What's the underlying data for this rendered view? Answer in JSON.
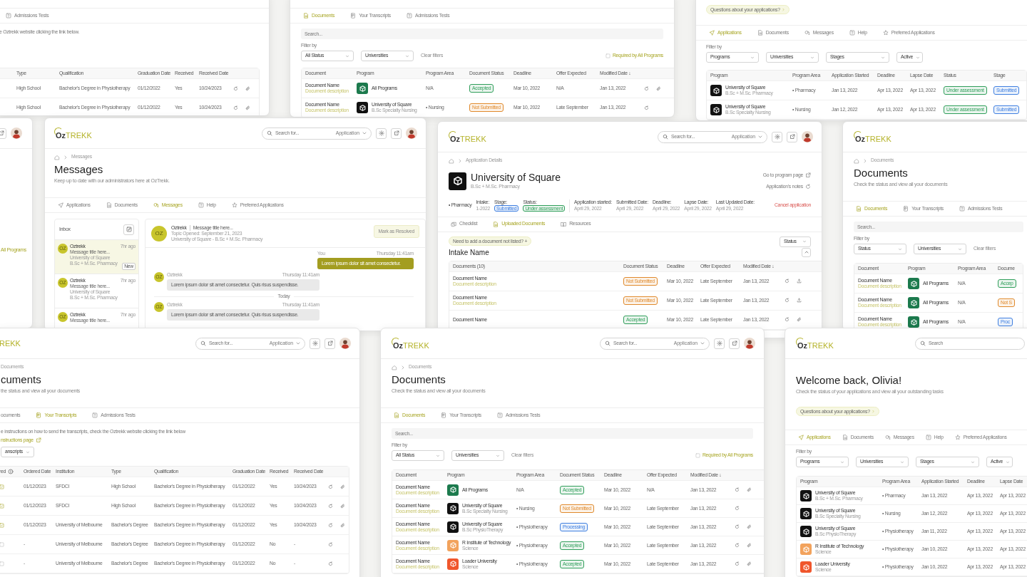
{
  "windows": [
    {
      "sections": [
        {
          "kind": "tabs",
          "items": [
            {
              "label": "Admissions Tests",
              "kind": "help",
              "selected": false
            }
          ]
        },
        {
          "kind": "note",
          "text": "e Oztrekk website clicking the link below."
        },
        {
          "kind": "table",
          "columns": [
            "Type",
            "Qualification",
            "Graduation Date",
            "Received",
            "Received Date"
          ],
          "rows": [
            [
              "High School",
              "Bachelor's Degree in Physiotherapy",
              "01/12/2022",
              "Yes",
              "10/24/2023",
              {
                "kind": "actions",
                "attachment": true
              }
            ],
            [
              "High School",
              "Bachelor's Degree in Physiotherapy",
              "01/12/2022",
              "Yes",
              "10/24/2023",
              {
                "kind": "actions",
                "attachment": true
              }
            ]
          ]
        }
      ]
    },
    {
      "sections": [
        {
          "kind": "tabs",
          "items": [
            {
              "label": "Documents",
              "kind": "doc",
              "selected": true
            },
            {
              "label": "Your Transcripts",
              "kind": "transcript",
              "selected": false
            },
            {
              "label": "Admissions Tests",
              "kind": "help",
              "selected": false
            }
          ]
        },
        {
          "kind": "searchbar",
          "placeholder": "Search..."
        },
        {
          "kind": "filters",
          "label": "Filter by",
          "selects": [
            "All Status",
            "Universities"
          ],
          "clear": "Clear filters",
          "checkbox": {
            "label": "Required by All Programs",
            "checked": false
          }
        },
        {
          "kind": "table",
          "columns": [
            "Document",
            "Program",
            "Program Area",
            "Document Status",
            "Deadline",
            "Offer Expected",
            "Modified Date ↓"
          ],
          "rows": [
            [
              {
                "kind": "doc",
                "name": "Document Name",
                "desc": "Document description"
              },
              {
                "kind": "program",
                "color": "#1c7a4d",
                "name": "All Programs"
              },
              "N/A",
              {
                "kind": "status",
                "text": "Accepted",
                "color": "#2f9e5a"
              },
              "Mar 10, 2022",
              "N/A",
              "Jan 13, 2022",
              {
                "kind": "actions",
                "attachment": true
              }
            ],
            [
              {
                "kind": "doc",
                "name": "Document Name",
                "desc": "Document description"
              },
              {
                "kind": "program",
                "color": "#111111",
                "name": "University of Square",
                "sub": "B.Sc Specialty Nursing"
              },
              "• Nursing",
              {
                "kind": "status",
                "text": "Not Submitted",
                "color": "#e0892b"
              },
              "Mar 10, 2022",
              "Late September",
              "Jan 13, 2022",
              {
                "kind": "actions",
                "attachment": false
              }
            ]
          ]
        }
      ]
    },
    {
      "sections": [
        {
          "kind": "pill",
          "text": "Questions about your applications?",
          "arrow": true
        },
        {
          "kind": "tabs",
          "items": [
            {
              "label": "Applications",
              "kind": "send",
              "selected": true
            },
            {
              "label": "Documents",
              "kind": "doc",
              "selected": false
            },
            {
              "label": "Messages",
              "kind": "chat",
              "selected": false
            },
            {
              "label": "Help",
              "kind": "help",
              "selected": false
            },
            {
              "label": "Preferred Applications",
              "kind": "star",
              "selected": false
            }
          ]
        },
        {
          "kind": "filters",
          "label": "Filter by",
          "selects": [
            "Programs",
            "Universities",
            "Stages",
            "Active"
          ]
        },
        {
          "kind": "table",
          "columns": [
            "Program",
            "Program Area",
            "Application Started",
            "Deadline",
            "Lapse Date",
            "Status",
            "Stage"
          ],
          "rows": [
            [
              {
                "kind": "program",
                "color": "#111111",
                "name": "University of Square",
                "sub": "B.Sc + M.Sc. Pharmacy"
              },
              "• Pharmacy",
              "Jan 13, 2022",
              "Apr 13, 2022",
              "Apr 13, 2022",
              {
                "kind": "status",
                "text": "Under assessment",
                "color": "#2f9e5a"
              },
              {
                "kind": "status",
                "text": "Submitted",
                "color": "#3f7fe0"
              }
            ],
            [
              {
                "kind": "program",
                "color": "#111111",
                "name": "University of Square",
                "sub": "B.Sc Specialty Nursing"
              },
              "• Nursing",
              "Jan 12, 2022",
              "Apr 13, 2022",
              "Apr 13, 2022",
              {
                "kind": "status",
                "text": "Under assessment",
                "color": "#2f9e5a"
              },
              {
                "kind": "status",
                "text": "Submitted",
                "color": "#3f7fe0"
              }
            ]
          ]
        }
      ]
    },
    {
      "sections": [
        {
          "kind": "header",
          "external": true,
          "avatar": true
        },
        {
          "kind": "label",
          "text": "All Programs"
        }
      ]
    },
    {
      "sections": [
        {
          "kind": "header",
          "logo": {
            "a": "Oz",
            "b": "TREKK"
          },
          "placeholder": "Search for...",
          "scope": "Application",
          "tools": true,
          "avatar": true
        },
        {
          "kind": "breadcrumb",
          "home": true,
          "text": "Messages"
        },
        {
          "kind": "title",
          "text": "Messages",
          "sub": "Keep up to date with our administrators here at OzTrekk."
        },
        {
          "kind": "tabs",
          "items": [
            {
              "label": "Applications",
              "kind": "send",
              "selected": false
            },
            {
              "label": "Documents",
              "kind": "doc",
              "selected": false
            },
            {
              "label": "Messages",
              "kind": "chat",
              "selected": true
            },
            {
              "label": "Help",
              "kind": "help",
              "selected": false
            },
            {
              "label": "Preferred Applications",
              "kind": "star",
              "selected": false
            }
          ]
        },
        {
          "kind": "messages",
          "inbox": {
            "title": "Inbox",
            "items": [
              {
                "avatar": "OZ",
                "sender": "Oztrekk",
                "time": "7hr ago",
                "subject": "Message title here...",
                "university": "University of Square",
                "program": "B.Sc + M.Sc. Pharmacy",
                "badge": "New",
                "selected": true
              },
              {
                "avatar": "OZ",
                "sender": "Oztrekk",
                "time": "7hr ago",
                "subject": "Message title here...",
                "university": "University of Square",
                "program": "B.Sc + M.Sc. Pharmacy",
                "selected": false
              },
              {
                "avatar": "OZ",
                "sender": "Oztrekk",
                "time": "7hr ago",
                "subject": "Message title here...",
                "selected": false
              }
            ]
          },
          "thread": {
            "avatar": "OZ",
            "sender": "Oztrekk",
            "subject": "Message title here...",
            "opened": "Topic Opened: September 21, 2023",
            "context": "University of Square - B.Sc + M.Sc. Pharmacy",
            "action": "Mark as Resolved",
            "messages": [
              {
                "kind": "sent",
                "author": "You",
                "time": "Thursday 11:41am",
                "text": "Lorem ipsum dolor sit amet consectetur."
              },
              {
                "kind": "received",
                "avatar": "OZ",
                "author": "Oztrekk",
                "time": "Thursday 11:41am",
                "text": "Lorem ipsum dolor sit amet consectetur. Quis risus suspendisse."
              },
              {
                "kind": "divider",
                "text": "Today"
              },
              {
                "kind": "received",
                "avatar": "OZ",
                "author": "Oztrekk",
                "time": "Thursday 11:41am",
                "text": "Lorem ipsum dolor sit amet consectetur. Quis risus suspendisse."
              }
            ]
          }
        }
      ]
    },
    {
      "sections": [
        {
          "kind": "header",
          "logo": {
            "a": "Oz",
            "b": "TREKK"
          },
          "placeholder": "Search for...",
          "scope": "Application",
          "tools": true,
          "avatar": true
        },
        {
          "kind": "breadcrumb",
          "home": true,
          "text": "Application Details"
        },
        {
          "kind": "apphead",
          "color": "#111111",
          "name": "University of Square",
          "program": "B.Sc + M.Sc. Pharmacy",
          "links": [
            {
              "text": "Go to program page",
              "kind": "external"
            },
            {
              "text": "Application's notes",
              "kind": "notes"
            }
          ]
        },
        {
          "kind": "appinfo",
          "area": "• Pharmacy",
          "left": [
            {
              "label": "Intake:",
              "value": "1-2022"
            },
            {
              "label": "Stage:",
              "value": "Submitted",
              "color": "#3f7fe0"
            },
            {
              "label": "Status:",
              "value": "Under assessment",
              "color": "#2f9e5a"
            }
          ],
          "right": [
            {
              "label": "Application started:",
              "value": "April 29, 2022"
            },
            {
              "label": "Submitted Date:",
              "value": "April 29, 2022"
            },
            {
              "label": "Deadline:",
              "value": "April 29, 2022"
            },
            {
              "label": "Lapse Date:",
              "value": "April 29, 2022"
            },
            {
              "label": "Last Updated Date:",
              "value": "April 29, 2022"
            }
          ],
          "cancel": "Cancel application"
        },
        {
          "kind": "tabs",
          "items": [
            {
              "label": "Checklist",
              "kind": "checklist",
              "selected": false
            },
            {
              "label": "Uploaded Documents",
              "kind": "doc",
              "selected": true
            },
            {
              "label": "Resources",
              "kind": "book",
              "selected": false
            }
          ]
        },
        {
          "kind": "doctoolbar",
          "pill": "Need to add a document not listed? +",
          "select": "Status",
          "heading": "Intake Name"
        },
        {
          "kind": "table",
          "columns": [
            "Documents (10)",
            "Document Status",
            "Deadline",
            "Offer Expected",
            "Modified Date ↓"
          ],
          "rows": [
            [
              {
                "kind": "doc",
                "name": "Document Name",
                "desc": "Document description"
              },
              {
                "kind": "status",
                "text": "Not Submitted",
                "color": "#e0892b"
              },
              "Mar 10, 2022",
              "Late September",
              "Jan 13, 2022",
              {
                "kind": "actions",
                "upload": true
              }
            ],
            [
              {
                "kind": "doc",
                "name": "Document Name",
                "desc": "Document description"
              },
              {
                "kind": "status",
                "text": "Not Submitted",
                "color": "#e0892b"
              },
              "Mar 10, 2022",
              "Late September",
              "Jan 13, 2022",
              {
                "kind": "actions",
                "upload": true
              }
            ],
            [
              {
                "kind": "doc",
                "name": "Document Name"
              },
              {
                "kind": "status",
                "text": "Accepted",
                "color": "#2f9e5a"
              },
              "Mar 10, 2022",
              "Late September",
              "Jan 13, 2022",
              {
                "kind": "actions",
                "attachment": true
              }
            ]
          ]
        }
      ]
    },
    {
      "sections": [
        {
          "kind": "header",
          "logo": {
            "a": "Oz",
            "b": "TREKK"
          }
        },
        {
          "kind": "breadcrumb",
          "home": true,
          "text": "Documents"
        },
        {
          "kind": "title",
          "text": "Documents",
          "sub": "Check the status and view all your documents"
        },
        {
          "kind": "tabs",
          "items": [
            {
              "label": "Documents",
              "kind": "doc",
              "selected": true
            },
            {
              "label": "Your Transcripts",
              "kind": "transcript",
              "selected": false
            },
            {
              "label": "Admissions Tests",
              "kind": "help",
              "selected": false
            }
          ]
        },
        {
          "kind": "searchbar",
          "placeholder": "Search..."
        },
        {
          "kind": "filters",
          "label": "Filter by",
          "selects": [
            "Status",
            "Universities"
          ],
          "clear": "Clear filters"
        },
        {
          "kind": "table",
          "columns": [
            "Document",
            "Program",
            "Program Area",
            "Docume"
          ],
          "rows": [
            [
              {
                "kind": "doc",
                "name": "Document Name",
                "desc": "Document description"
              },
              {
                "kind": "program",
                "color": "#1c7a4d",
                "name": "All Programs"
              },
              "N/A",
              {
                "kind": "status",
                "text": "Accep",
                "color": "#2f9e5a"
              }
            ],
            [
              {
                "kind": "doc",
                "name": "Document Name",
                "desc": "Document description"
              },
              {
                "kind": "program",
                "color": "#1c7a4d",
                "name": "All Programs"
              },
              "N/A",
              {
                "kind": "status",
                "text": "Not S",
                "color": "#e0892b"
              }
            ],
            [
              {
                "kind": "doc",
                "name": "Document Name",
                "desc": "Document description"
              },
              {
                "kind": "program",
                "color": "#1c7a4d",
                "name": "All Programs"
              },
              "N/A",
              {
                "kind": "status",
                "text": "Proc",
                "color": "#3f7fe0"
              }
            ]
          ]
        }
      ]
    },
    {
      "sections": [
        {
          "kind": "header",
          "logo": {
            "b": "REKK"
          },
          "placeholder": "Search for...",
          "scope": "Application",
          "tools": true,
          "avatar": true
        },
        {
          "kind": "breadcrumb",
          "text": "Documents"
        },
        {
          "kind": "title",
          "text": "cuments",
          "sub": "the status and view all your documents"
        },
        {
          "kind": "tabs",
          "items": [
            {
              "label": "ocuments",
              "selected": false
            },
            {
              "label": "Your Transcripts",
              "kind": "transcript",
              "selected": true
            },
            {
              "label": "Admissions Tests",
              "kind": "help",
              "selected": false
            }
          ]
        },
        {
          "kind": "note",
          "text": "e instructions on how to send the transcripts, check the Oztrekk website clicking the link below"
        },
        {
          "kind": "link",
          "text": "nstructions page"
        },
        {
          "kind": "select",
          "text": "anscripts"
        },
        {
          "kind": "table",
          "columns": [
            {
              "label": "red",
              "info": true
            },
            "Ordered Date",
            "Institution",
            "Type",
            "Qualification",
            "Graduation Date",
            "Received",
            "Received Date"
          ],
          "rows": [
            [
              {
                "kind": "check",
                "checked": true
              },
              "01/12/2023",
              "SFDCI",
              "High School",
              "Bachelor's Degree in Physiotherapy",
              "01/12/2022",
              "Yes",
              "10/24/2023",
              {
                "kind": "actions",
                "attachment": true
              }
            ],
            [
              {
                "kind": "check",
                "checked": true
              },
              "01/12/2023",
              "SFDCI",
              "High School",
              "Bachelor's Degree in Physiotherapy",
              "01/12/2022",
              "Yes",
              "10/24/2023",
              {
                "kind": "actions",
                "attachment": true
              }
            ],
            [
              {
                "kind": "check",
                "checked": true
              },
              "01/12/2023",
              "University of Melbourne",
              "Bachelor's Degree",
              "Bachelor's Degree in Physiotherapy",
              "01/12/2022",
              "Yes",
              "10/24/2023",
              {
                "kind": "actions",
                "attachment": true
              }
            ],
            [
              {
                "kind": "check",
                "checked": false
              },
              "-",
              "University of Melbourne",
              "Bachelor's Degree",
              "Bachelor's Degree in Physiotherapy",
              "01/12/2022",
              "No",
              "-",
              {
                "kind": "actions",
                "attachment": false
              }
            ],
            [
              {
                "kind": "check",
                "checked": false
              },
              "-",
              "University of Melbourne",
              "Bachelor's Degree",
              "Bachelor's Degree in Physiotherapy",
              "01/12/2022",
              "No",
              "-",
              {
                "kind": "actions",
                "attachment": false
              }
            ]
          ]
        }
      ]
    },
    {
      "sections": [
        {
          "kind": "header",
          "logo": {
            "a": "Oz",
            "b": "TREKK"
          },
          "placeholder": "Search for...",
          "scope": "Application",
          "tools": true,
          "avatar": true
        },
        {
          "kind": "breadcrumb",
          "home": true,
          "text": "Documents"
        },
        {
          "kind": "title",
          "text": "Documents",
          "sub": "Check the status and view all your documents"
        },
        {
          "kind": "tabs",
          "items": [
            {
              "label": "Documents",
              "kind": "doc",
              "selected": true
            },
            {
              "label": "Your Transcripts",
              "kind": "transcript",
              "selected": false
            },
            {
              "label": "Admissions Tests",
              "kind": "help",
              "selected": false
            }
          ]
        },
        {
          "kind": "searchbar",
          "placeholder": "Search..."
        },
        {
          "kind": "filters",
          "label": "Filter by",
          "selects": [
            "All Status",
            "Universities"
          ],
          "clear": "Clear filters",
          "checkbox": {
            "label": "Required by All Programs",
            "checked": false
          }
        },
        {
          "kind": "table",
          "columns": [
            "Document",
            "Program",
            "Program Area",
            "Document Status",
            "Deadline",
            "Offer Expected",
            "Modified Date ↓"
          ],
          "rows": [
            [
              {
                "kind": "doc",
                "name": "Document Name",
                "desc": "Document description"
              },
              {
                "kind": "program",
                "color": "#1c7a4d",
                "name": "All Programs"
              },
              "N/A",
              {
                "kind": "status",
                "text": "Accepted",
                "color": "#2f9e5a"
              },
              "Mar 10, 2022",
              "N/A",
              "Jan 13, 2022",
              {
                "kind": "actions",
                "attachment": true
              }
            ],
            [
              {
                "kind": "doc",
                "name": "Document Name",
                "desc": "Document description"
              },
              {
                "kind": "program",
                "color": "#111111",
                "name": "University of Square",
                "sub": "B.Sc Specialty Nursing"
              },
              "• Nursing",
              {
                "kind": "status",
                "text": "Not Submitted",
                "color": "#e0892b"
              },
              "Mar 10, 2022",
              "Late September",
              "Jan 13, 2022",
              {
                "kind": "actions",
                "attachment": false
              }
            ],
            [
              {
                "kind": "doc",
                "name": "Document Name",
                "desc": "Document description"
              },
              {
                "kind": "program",
                "color": "#111111",
                "name": "University of Square",
                "sub": "B.Sc PhysioTherapy"
              },
              "• Physiotherapy",
              {
                "kind": "status",
                "text": "Processing",
                "color": "#3f7fe0"
              },
              "Mar 10, 2022",
              "Late September",
              "Jan 13, 2022",
              {
                "kind": "actions",
                "attachment": true
              }
            ],
            [
              {
                "kind": "doc",
                "name": "Document Name",
                "desc": "Document description"
              },
              {
                "kind": "program",
                "color": "#f2a25c",
                "name": "R Institute of Technology",
                "sub": "Science"
              },
              "• Physiotherapy",
              {
                "kind": "status",
                "text": "Accepted",
                "color": "#2f9e5a"
              },
              "Mar 10, 2022",
              "Late September",
              "Jan 13, 2022",
              {
                "kind": "actions",
                "attachment": true
              }
            ],
            [
              {
                "kind": "doc",
                "name": "Document Name",
                "desc": "Document description"
              },
              {
                "kind": "program",
                "color": "#f0562c",
                "name": "Loader University",
                "sub": "Science"
              },
              "• Physiotherapy",
              {
                "kind": "status",
                "text": "Accepted",
                "color": "#2f9e5a"
              },
              "Mar 10, 2022",
              "Late September",
              "Jan 13, 2022",
              {
                "kind": "actions",
                "attachment": true
              }
            ]
          ]
        }
      ]
    },
    {
      "sections": [
        {
          "kind": "header",
          "logo": {
            "a": "Oz",
            "b": "TREKK"
          },
          "placeholder": "Search"
        },
        {
          "kind": "title",
          "text": "Welcome back, Olivia!",
          "sub": "Check the status of your applications and view all your outstanding tasks"
        },
        {
          "kind": "pill",
          "text": "Questions about your applications?",
          "arrow": true
        },
        {
          "kind": "tabs",
          "items": [
            {
              "label": "Applications",
              "kind": "send",
              "selected": true
            },
            {
              "label": "Documents",
              "kind": "doc",
              "selected": false
            },
            {
              "label": "Messages",
              "kind": "chat",
              "selected": false
            },
            {
              "label": "Help",
              "kind": "help",
              "selected": false
            },
            {
              "label": "Preferred Applications",
              "kind": "star",
              "selected": false
            }
          ]
        },
        {
          "kind": "filters",
          "label": "Filter by",
          "selects": [
            "Programs",
            "Universities",
            "Stages",
            "Active"
          ]
        },
        {
          "kind": "table",
          "columns": [
            "Program",
            "Program Area",
            "Application Started",
            "Deadline",
            "Lapse Date"
          ],
          "rows": [
            [
              {
                "kind": "program",
                "color": "#111111",
                "name": "University of Square",
                "sub": "B.Sc + M.Sc. Pharmacy"
              },
              "• Pharmacy",
              "Jan 13, 2022",
              "Apr 13, 2022",
              "Apr 13, 2022"
            ],
            [
              {
                "kind": "program",
                "color": "#111111",
                "name": "University of Square",
                "sub": "B.Sc Specialty Nursing"
              },
              "• Nursing",
              "Jan 12, 2022",
              "Apr 13, 2022",
              "Apr 13, 2022"
            ],
            [
              {
                "kind": "program",
                "color": "#111111",
                "name": "University of Square",
                "sub": "B.Sc PhysioTherapy"
              },
              "• Physiotherapy",
              "Jan 11, 2022",
              "Apr 13, 2022",
              "Apr 13, 2022"
            ],
            [
              {
                "kind": "program",
                "color": "#f2a25c",
                "name": "R Institute of Technology",
                "sub": "Science"
              },
              "• Physiotherapy",
              "Jan 10, 2022",
              "Apr 13, 2022",
              "Apr 13, 2022"
            ],
            [
              {
                "kind": "program",
                "color": "#f0562c",
                "name": "Loader University",
                "sub": "Science"
              },
              "• Physiotherapy",
              "Jan 10, 2022",
              "Apr 13, 2022",
              "Apr 13, 2022"
            ]
          ]
        }
      ]
    }
  ]
}
